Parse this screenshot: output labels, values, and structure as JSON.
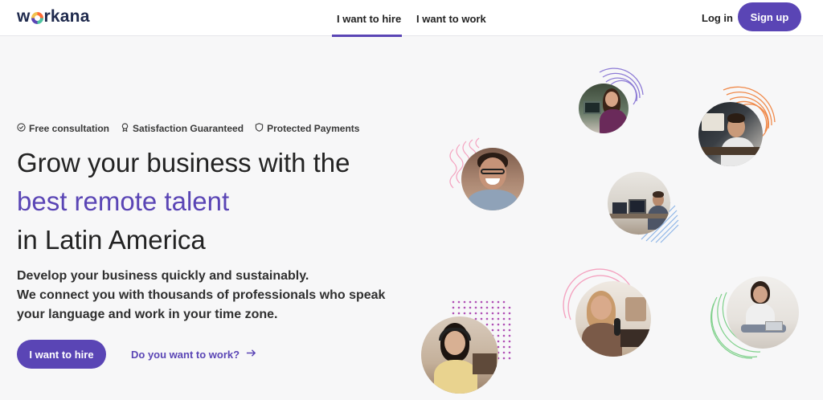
{
  "brand": {
    "name_prefix": "w",
    "name_suffix": "rkana",
    "accent": "#5a45b5"
  },
  "nav": {
    "tabs": [
      {
        "label": "I want to hire",
        "active": true
      },
      {
        "label": "I want to work",
        "active": false
      }
    ],
    "login_label": "Log in",
    "signup_label": "Sign up"
  },
  "hero": {
    "features": [
      {
        "icon": "check-circle-icon",
        "label": "Free consultation"
      },
      {
        "icon": "award-icon",
        "label": "Satisfaction Guaranteed"
      },
      {
        "icon": "shield-icon",
        "label": "Protected Payments"
      }
    ],
    "headline_line1": "Grow your business with the",
    "headline_line2": "best remote talent",
    "headline_line3": "in Latin America",
    "subtext_line1": "Develop your business quickly and sustainably.",
    "subtext_line2": "We connect you with thousands of professionals who speak",
    "subtext_line3": "your language and work in your time zone.",
    "cta_hire_label": "I want to hire",
    "cta_work_label": "Do you want to work?"
  },
  "photos": [
    {
      "name": "woman-at-desk-photo",
      "decoration": "lines",
      "deco_color": "#8e7cd6"
    },
    {
      "name": "man-with-headset-photo",
      "decoration": "lines",
      "deco_color": "#f08a4b"
    },
    {
      "name": "smiling-man-glasses-photo",
      "decoration": "waves",
      "deco_color": "#f4a3c0"
    },
    {
      "name": "man-at-computer-photo",
      "decoration": "stripes",
      "deco_color": "#8fb6e8"
    },
    {
      "name": "woman-with-microphone-photo",
      "decoration": "rings",
      "deco_color": "#f4a3c0"
    },
    {
      "name": "woman-on-floor-laptop-photo",
      "decoration": "lines",
      "deco_color": "#7ed08a"
    },
    {
      "name": "woman-with-headphones-photo",
      "decoration": "dots",
      "deco_color": "#b04fb5"
    }
  ]
}
